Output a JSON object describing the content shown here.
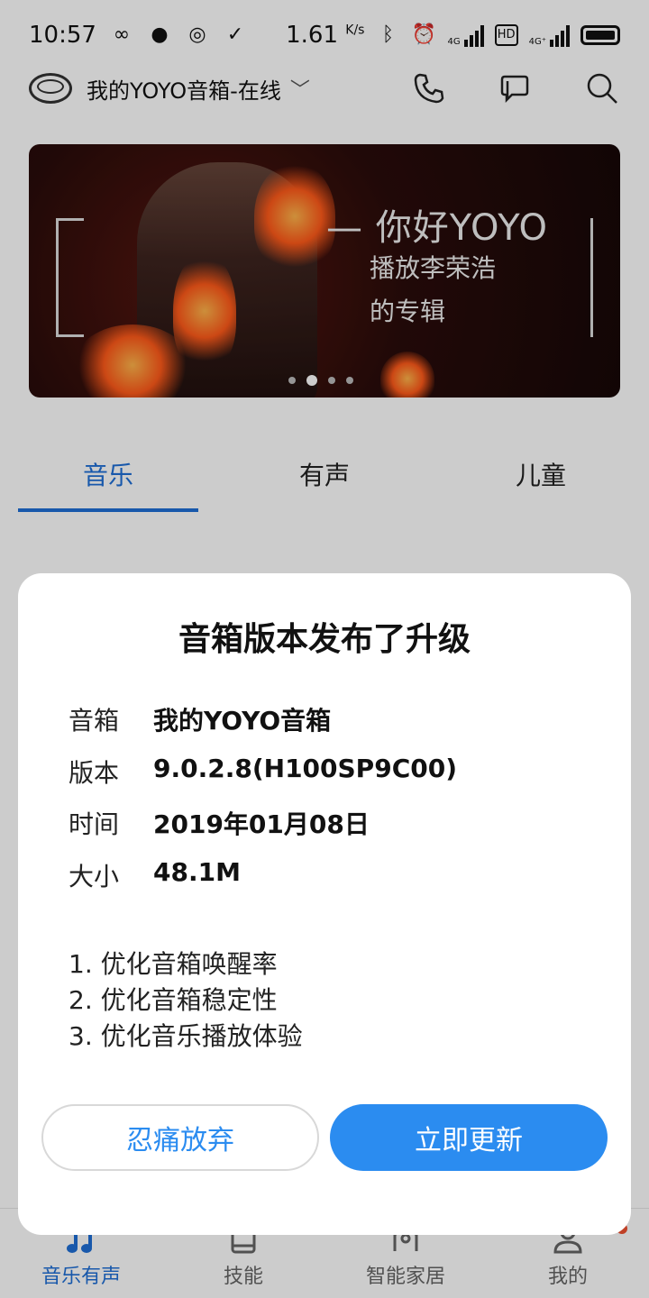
{
  "status_bar": {
    "time": "10:57",
    "speed": "1.61",
    "speed_unit": "K/s",
    "net_1": "4G",
    "net_2": "4G⁺"
  },
  "top_bar": {
    "device_label": "我的YOYO音箱-在线",
    "icons": [
      "phone-icon",
      "chat-icon",
      "search-icon"
    ]
  },
  "banner": {
    "title": "你好YOYO",
    "subtitle_line1": "播放李荣浩",
    "subtitle_line2": "的专辑",
    "page_count": 4,
    "active_page": 2
  },
  "tabs": [
    {
      "label": "音乐",
      "active": true
    },
    {
      "label": "有声",
      "active": false
    },
    {
      "label": "儿童",
      "active": false
    }
  ],
  "dialog": {
    "title": "音箱版本发布了升级",
    "rows": [
      {
        "key": "音箱",
        "value": "我的YOYO音箱"
      },
      {
        "key": "版本",
        "value": "9.0.2.8(H100SP9C00)"
      },
      {
        "key": "时间",
        "value": "2019年01月08日"
      },
      {
        "key": "大小",
        "value": "48.1M"
      }
    ],
    "notes": [
      "1. 优化音箱唤醒率",
      "2. 优化音箱稳定性",
      "3. 优化音乐播放体验"
    ],
    "cancel_label": "忍痛放弃",
    "confirm_label": "立即更新"
  },
  "bottom_nav": [
    {
      "label": "音乐有声",
      "active": true,
      "icon": "music-note-icon"
    },
    {
      "label": "技能",
      "active": false,
      "icon": "book-icon"
    },
    {
      "label": "智能家居",
      "active": false,
      "icon": "smart-home-icon"
    },
    {
      "label": "我的",
      "active": false,
      "icon": "profile-icon"
    }
  ],
  "colors": {
    "accent": "#2b8cf0",
    "tab_active": "#1e6fd6",
    "badge": "#f05030"
  }
}
